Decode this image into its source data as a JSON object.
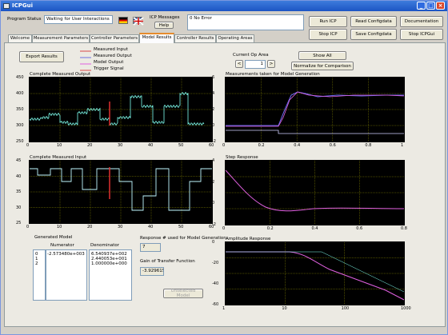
{
  "window": {
    "title": "ICPGui"
  },
  "header": {
    "program_status_label": "Program Status",
    "program_status_value": "Waiting for User Interactions",
    "icp_messages_label": "ICP Messages",
    "help_button": "Help",
    "error_message": "0 No Error"
  },
  "toolbar": {
    "run_icp": "Run ICP",
    "read_configdata": "Read Configdata",
    "documentation": "Documentation",
    "stop_icp": "Stop ICP",
    "save_configdata": "Save Configdata",
    "stop_icpgui": "Stop ICPGui"
  },
  "tabs": [
    "Welcome",
    "Measurement Parameters",
    "Controller Parameters",
    "Model Results",
    "Controller Results",
    "Operating Areas"
  ],
  "active_tab": 3,
  "controls": {
    "export_results": "Export Results",
    "current_op_area_label": "Current Op Area",
    "current_op_area_value": "1",
    "prev_arrow": "<",
    "next_arrow": ">",
    "show_all": "Show All",
    "normalize": "Normalize for Comparison"
  },
  "legend": {
    "items": [
      {
        "label": "Measured Input",
        "color": "#d94848"
      },
      {
        "label": "Measured Output",
        "color": "#7070e0"
      },
      {
        "label": "Model Output",
        "color": "#e060e0"
      },
      {
        "label": "Trigger Signal",
        "color": "#d94848"
      }
    ]
  },
  "plots": {
    "output": {
      "title": "Complete Measured Output",
      "yticks": [
        "450",
        "400",
        "350",
        "300",
        "250"
      ],
      "xticks": [
        "0",
        "10",
        "20",
        "30",
        "40",
        "50",
        "60"
      ]
    },
    "input": {
      "title": "Complete Measured Input",
      "yticks": [
        "45",
        "40",
        "35",
        "30",
        "25"
      ],
      "xticks": [
        "0",
        "10",
        "20",
        "30",
        "40",
        "50",
        "60"
      ]
    },
    "measurements": {
      "title": "Measurements taken for Model Generation",
      "yticks": [
        "6",
        "4",
        "2",
        "0",
        "-2"
      ],
      "xticks": [
        "0",
        "0.2",
        "0.4",
        "0.6",
        "0.8",
        "1"
      ]
    },
    "step": {
      "title": "Step Response",
      "yticks": [
        "4",
        "2",
        "0",
        "-2"
      ],
      "xticks": [
        "0",
        "0.2",
        "0.4",
        "0.6",
        "0.8"
      ]
    },
    "amplitude": {
      "title": "Amplitude Response",
      "yticks": [
        "0",
        "-20",
        "-40",
        "-60"
      ],
      "xticks": [
        "1",
        "10",
        "100",
        "1000"
      ]
    }
  },
  "model": {
    "generated_label": "Generated Model",
    "numerator_label": "Numerator",
    "denominator_label": "Denominator",
    "rows": [
      {
        "index": "0",
        "numerator": "-2.573480e+003",
        "denominator": "6.540937e+002"
      },
      {
        "index": "1",
        "numerator": "",
        "denominator": "2.440053e+001"
      },
      {
        "index": "2",
        "numerator": "",
        "denominator": "1.000000e+000"
      }
    ],
    "response_label": "Response # used for Model Generation",
    "response_value": "7",
    "gain_label": "Gain of Transfer Function",
    "gain_value": "-3.929615",
    "unselect_model": "Unselected Model"
  },
  "colors": {
    "plot_bg": "#000000",
    "grid": "#b8b800",
    "cyan": "#7fffef",
    "blue": "#6b6bf0",
    "magenta": "#e060e0",
    "red": "#e03030"
  }
}
